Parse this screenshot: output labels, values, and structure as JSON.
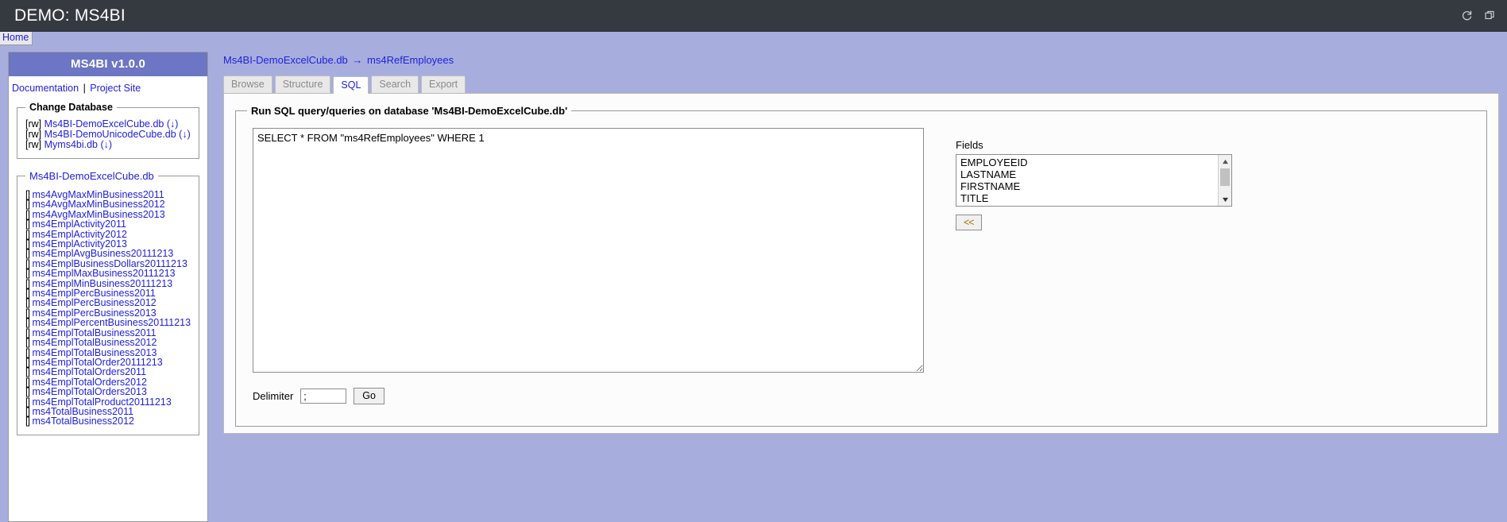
{
  "window": {
    "title": "DEMO: MS4BI",
    "icons": [
      {
        "name": "refresh-icon",
        "label": "Reload"
      },
      {
        "name": "duplicate-window-icon",
        "label": "Duplicate"
      }
    ]
  },
  "homebar": {
    "home_label": "Home"
  },
  "sidebar": {
    "header": "MS4BI v1.0.0",
    "links": [
      {
        "label": "Documentation"
      },
      {
        "label": "Project Site"
      }
    ],
    "link_separator": "|",
    "change_database": {
      "legend": "Change Database",
      "items": [
        {
          "mode": "[rw]",
          "name": "Ms4BI-DemoExcelCube.db",
          "download": "(↓)"
        },
        {
          "mode": "[rw]",
          "name": "Ms4BI-DemoUnicodeCube.db",
          "download": "(↓)"
        },
        {
          "mode": "[rw]",
          "name": "Myms4bi.db",
          "download": "(↓)"
        }
      ]
    },
    "tables": {
      "legend": "Ms4BI-DemoExcelCube.db",
      "bullet": "[]",
      "items": [
        "ms4AvgMaxMinBusiness2011",
        "ms4AvgMaxMinBusiness2012",
        "ms4AvgMaxMinBusiness2013",
        "ms4EmplActivity2011",
        "ms4EmplActivity2012",
        "ms4EmplActivity2013",
        "ms4EmplAvgBusiness20111213",
        "ms4EmplBusinessDollars20111213",
        "ms4EmplMaxBusiness20111213",
        "ms4EmplMinBusiness20111213",
        "ms4EmplPercBusiness2011",
        "ms4EmplPercBusiness2012",
        "ms4EmplPercBusiness2013",
        "ms4EmplPercentBusiness20111213",
        "ms4EmplTotalBusiness2011",
        "ms4EmplTotalBusiness2012",
        "ms4EmplTotalBusiness2013",
        "ms4EmplTotalOrder20111213",
        "ms4EmplTotalOrders2011",
        "ms4EmplTotalOrders2012",
        "ms4EmplTotalOrders2013",
        "ms4EmplTotalProduct20111213",
        "ms4TotalBusiness2011",
        "ms4TotalBusiness2012"
      ]
    }
  },
  "breadcrumb": {
    "database": "Ms4BI-DemoExcelCube.db",
    "arrow": "→",
    "table": "ms4RefEmployees"
  },
  "tabs": [
    {
      "label": "Browse",
      "active": false
    },
    {
      "label": "Structure",
      "active": false
    },
    {
      "label": "SQL",
      "active": true
    },
    {
      "label": "Search",
      "active": false
    },
    {
      "label": "Export",
      "active": false
    }
  ],
  "sql_panel": {
    "legend": "Run SQL query/queries on database 'Ms4BI-DemoExcelCube.db'",
    "query": "SELECT * FROM \"ms4RefEmployees\" WHERE 1",
    "query_placeholder": "",
    "delimiter_label": "Delimiter",
    "delimiter_value": ";",
    "go_label": "Go"
  },
  "fields_panel": {
    "label": "Fields",
    "options": [
      "EMPLOYEEID",
      "LASTNAME",
      "FIRSTNAME",
      "TITLE"
    ],
    "insert_button_label": "<<"
  },
  "colors": {
    "titlebar_bg": "#343a40",
    "page_bg": "#a7aede",
    "sidebar_header_bg": "#6c76c4",
    "link": "#2020e0",
    "tab_active_text": "#2020e0",
    "tab_inactive_text": "#8a8a8a"
  }
}
